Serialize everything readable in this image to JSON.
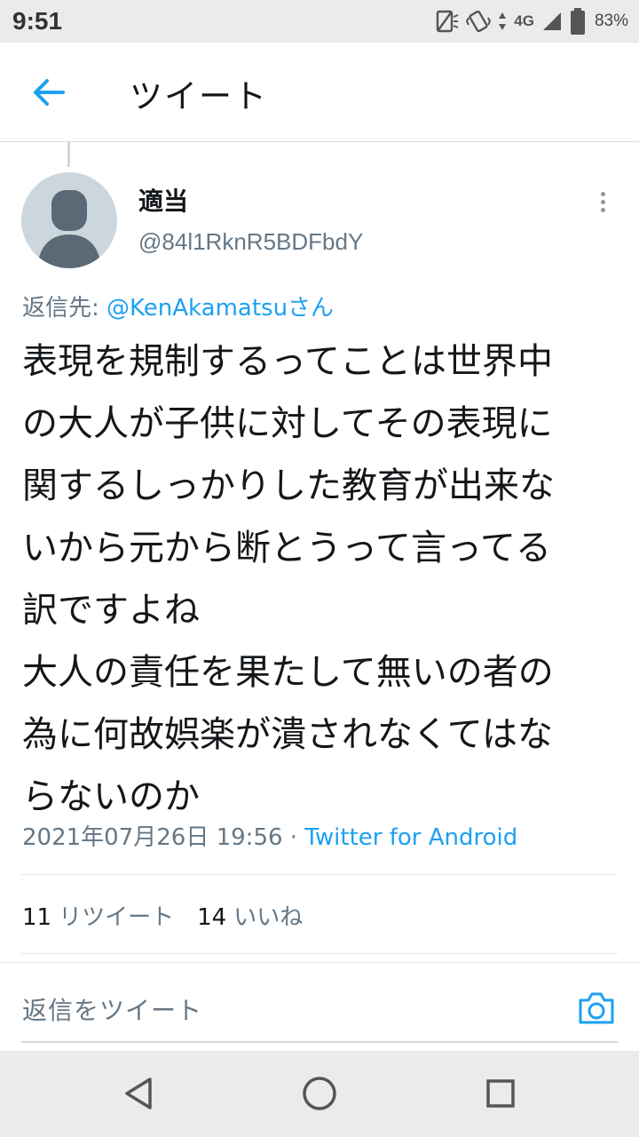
{
  "status_bar": {
    "time": "9:51",
    "network": "4G",
    "battery": "83%"
  },
  "header": {
    "title": "ツイート",
    "back_icon": "arrow-left-icon"
  },
  "tweet": {
    "display_name": "適当",
    "handle": "@84l1RknR5BDFbdY",
    "reply_prefix": "返信先: ",
    "reply_mention": "@KenAkamatsuさん",
    "text": "表現を規制するってことは世界中\nの大人が子供に対してその表現に\n関するしっかりした教育が出来な\nいから元から断とうって言ってる\n訳ですよね\n大人の責任を果たして無いの者の\n為に何故娯楽が潰されなくてはな\nらないのか",
    "timestamp": "2021年07月26日 19:56",
    "separator": " · ",
    "source": "Twitter for Android",
    "retweet_count": "11",
    "retweet_label": "リツイート",
    "like_count": "14",
    "like_label": "いいね"
  },
  "reply_bar": {
    "placeholder": "返信をツイート"
  },
  "colors": {
    "accent": "#1da1f2",
    "secondary_text": "#657786"
  }
}
